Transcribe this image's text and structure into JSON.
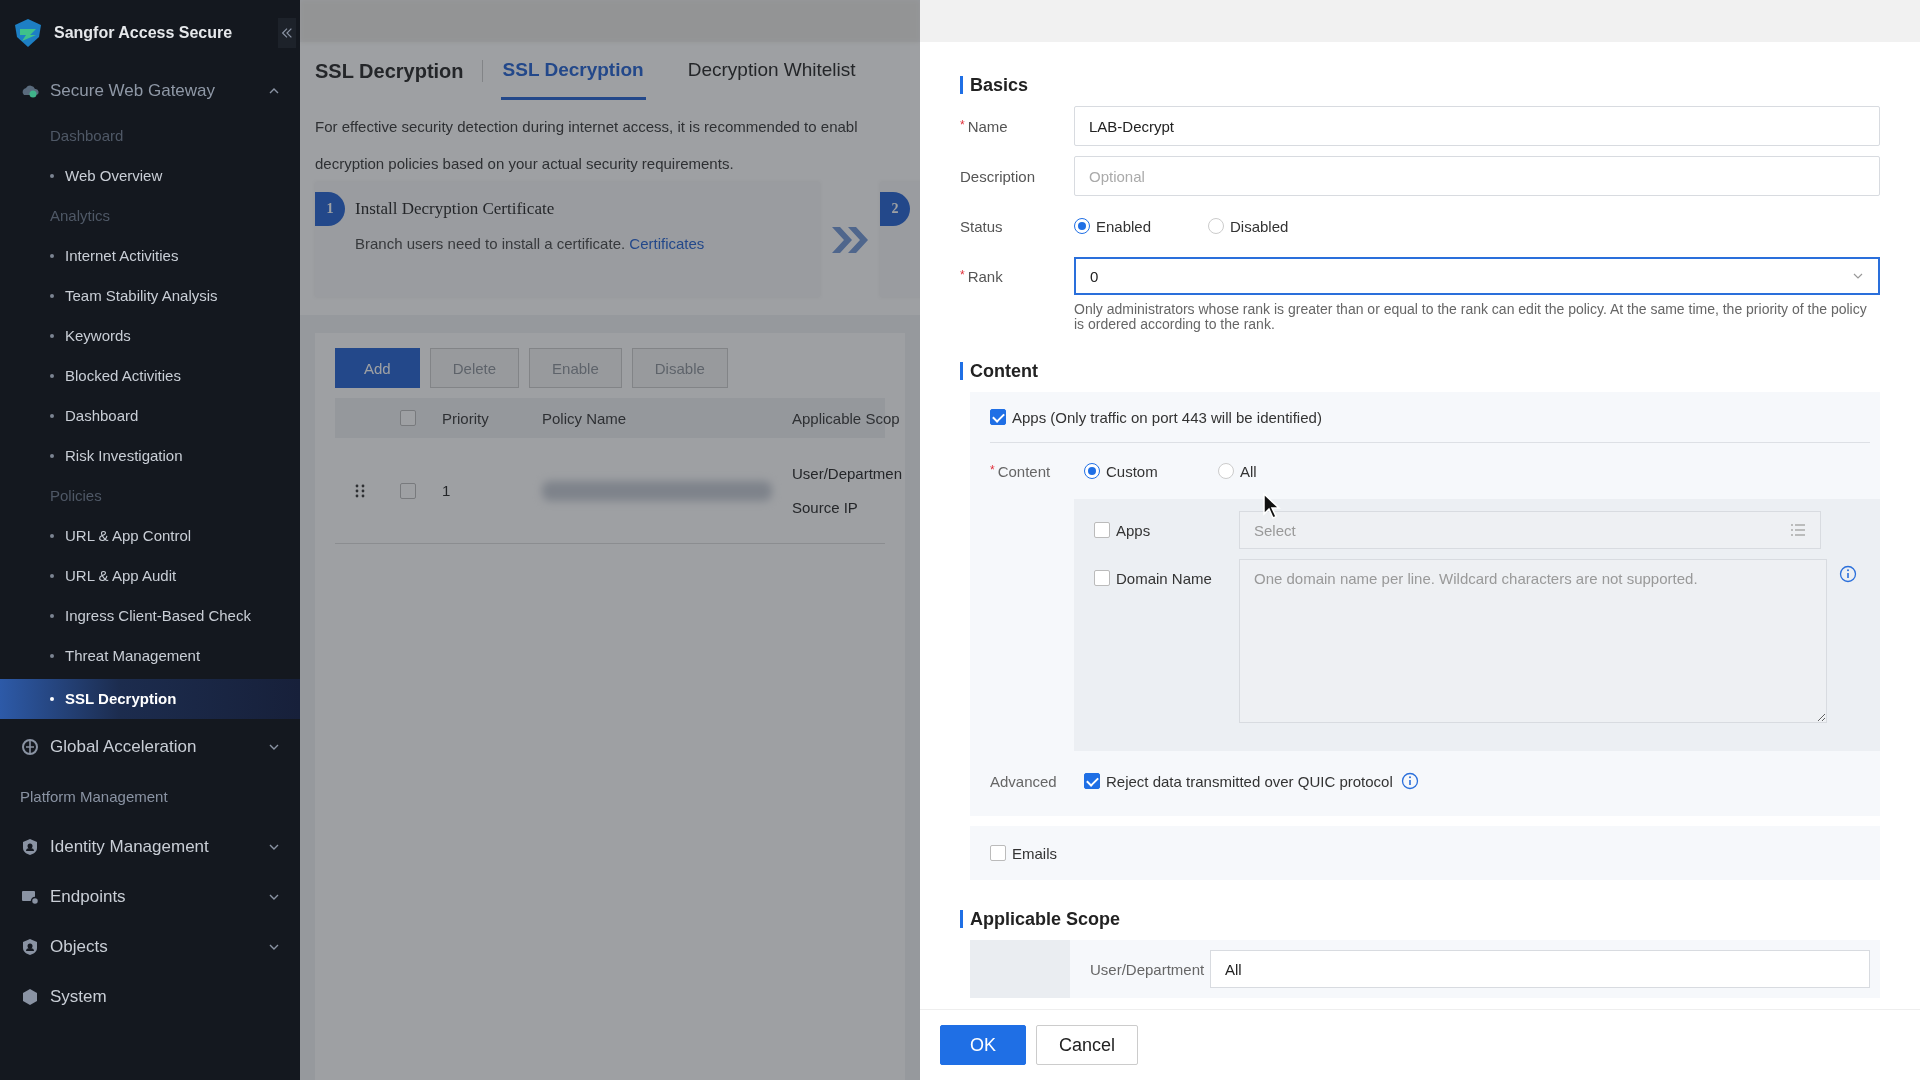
{
  "sidebar": {
    "brand": "Sangfor Access Secure",
    "items": [
      {
        "kind": "group",
        "label": "Secure Web Gateway",
        "expanded": true,
        "children": [
          {
            "kind": "heading",
            "label": "Dashboard"
          },
          {
            "kind": "item",
            "label": "Web Overview",
            "selected": false
          },
          {
            "kind": "heading",
            "label": "Analytics"
          },
          {
            "kind": "item",
            "label": "Internet Activities",
            "selected": false
          },
          {
            "kind": "item",
            "label": "Team Stability Analysis",
            "selected": false
          },
          {
            "kind": "item",
            "label": "Keywords",
            "selected": false
          },
          {
            "kind": "item",
            "label": "Blocked Activities",
            "selected": false
          },
          {
            "kind": "item",
            "label": "Dashboard",
            "selected": false
          },
          {
            "kind": "item",
            "label": "Risk Investigation",
            "selected": false
          },
          {
            "kind": "heading",
            "label": "Policies"
          },
          {
            "kind": "item",
            "label": "URL & App Control",
            "selected": false
          },
          {
            "kind": "item",
            "label": "URL & App Audit",
            "selected": false
          },
          {
            "kind": "item",
            "label": "Ingress Client-Based Check",
            "selected": false
          },
          {
            "kind": "item",
            "label": "Threat Management",
            "selected": false
          },
          {
            "kind": "item",
            "label": "SSL Decryption",
            "selected": true
          }
        ]
      },
      {
        "kind": "group",
        "label": "Global Acceleration",
        "expanded": false
      },
      {
        "kind": "section",
        "label": "Platform Management"
      },
      {
        "kind": "group",
        "label": "Identity Management",
        "expanded": false
      },
      {
        "kind": "group",
        "label": "Endpoints",
        "expanded": false
      },
      {
        "kind": "group",
        "label": "Objects",
        "expanded": false
      },
      {
        "kind": "link",
        "label": "System"
      }
    ]
  },
  "main": {
    "title": "SSL Decryption",
    "tabs": [
      {
        "label": "SSL Decryption",
        "selected": true
      },
      {
        "label": "Decryption Whitelist",
        "selected": false
      }
    ],
    "notice": [
      "For effective security detection during internet access, it is recommended to enabl",
      "decryption policies based on your actual security requirements."
    ],
    "steps": [
      {
        "number": "1",
        "title": "Install Decryption Certificate",
        "text": "Branch users need to install a certificate.",
        "link": "Certificates"
      },
      {
        "number": "2"
      }
    ],
    "toolbar": [
      {
        "label": "Add",
        "kind": "primary",
        "disabled": false
      },
      {
        "label": "Delete",
        "kind": "default",
        "disabled": true
      },
      {
        "label": "Enable",
        "kind": "default",
        "disabled": true
      },
      {
        "label": "Disable",
        "kind": "default",
        "disabled": true
      }
    ],
    "table": {
      "header_checked": false,
      "columns": [
        "Priority",
        "Policy Name",
        "Applicable Scop"
      ],
      "rows": [
        {
          "checked": false,
          "priority": "1",
          "scope": [
            "User/Departmen",
            "Source IP"
          ]
        }
      ]
    }
  },
  "drawer": {
    "required_mark": "*",
    "basics": {
      "title": "Basics",
      "name": {
        "label": "Name",
        "required": true,
        "value": "LAB-Decrypt"
      },
      "description": {
        "label": "Description",
        "placeholder": "Optional"
      },
      "status": {
        "label": "Status",
        "options": [
          {
            "label": "Enabled",
            "selected": true
          },
          {
            "label": "Disabled",
            "selected": false
          }
        ]
      },
      "rank": {
        "label": "Rank",
        "required": true,
        "value": "0"
      },
      "rank_hint": "Only administrators whose rank is greater than or equal to the rank can edit the policy. At the same time, the priority of the policy is ordered according to the rank."
    },
    "content": {
      "title": "Content",
      "apps": {
        "label": "Apps (Only traffic on port 443 will be identified)",
        "checked": true
      },
      "mode": {
        "label": "Content",
        "required": true,
        "options": [
          {
            "label": "Custom",
            "selected": true
          },
          {
            "label": "All",
            "selected": false
          }
        ]
      },
      "items": [
        {
          "kind": "select",
          "label": "Apps",
          "checked": false,
          "placeholder": "Select"
        },
        {
          "kind": "textarea",
          "label": "Domain Name",
          "checked": false,
          "placeholder": "One domain name per line. Wildcard characters are not supported."
        }
      ],
      "advanced": {
        "label": "Advanced",
        "option": "Reject data transmitted over QUIC protocol",
        "checked": true
      },
      "emails": {
        "label": "Emails",
        "checked": false
      }
    },
    "scope": {
      "title": "Applicable Scope",
      "field": {
        "label": "User/Department",
        "value": "All"
      }
    },
    "buttons": [
      {
        "label": "OK",
        "kind": "primary"
      },
      {
        "label": "Cancel",
        "kind": "default"
      }
    ]
  }
}
